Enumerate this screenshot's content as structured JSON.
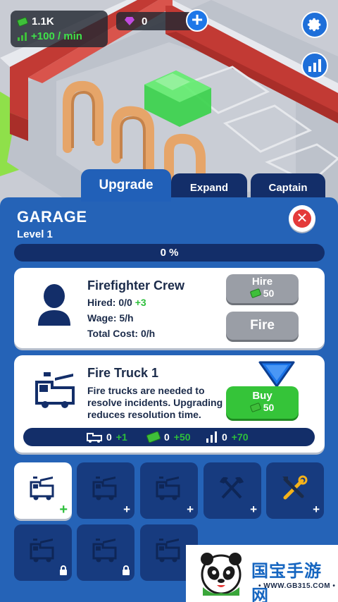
{
  "hud": {
    "money": "1.1K",
    "income_rate": "+100 / min",
    "gems": "0"
  },
  "tabs": [
    {
      "label": "Upgrade",
      "active": true
    },
    {
      "label": "Expand",
      "active": false
    },
    {
      "label": "Captain",
      "active": false
    }
  ],
  "panel": {
    "title": "GARAGE",
    "level": "Level 1",
    "progress_text": "0 %",
    "progress_fraction": 0
  },
  "crew_card": {
    "title": "Firefighter Crew",
    "hired_label": "Hired: 0/0",
    "hired_bonus": "+3",
    "wage": "Wage: 5/h",
    "total_cost": "Total Cost: 0/h",
    "hire_button": "Hire",
    "hire_price": "50",
    "fire_button": "Fire"
  },
  "truck_card": {
    "title": "Fire Truck 1",
    "description_lines": [
      "Fire trucks are needed to",
      "resolve incidents. Upgrading",
      "reduces resolution time."
    ],
    "buy_button": "Buy",
    "buy_price": "50",
    "stats": [
      {
        "icon": "fire-truck-icon",
        "value": "0",
        "bonus": "+1"
      },
      {
        "icon": "cash-icon",
        "value": "0",
        "bonus": "+50"
      },
      {
        "icon": "speed-icon",
        "value": "0",
        "bonus": "+70"
      }
    ]
  },
  "slots": [
    {
      "icon": "fire-truck-icon",
      "badge": "+",
      "selected": true
    },
    {
      "icon": "fire-truck-icon",
      "badge": "+",
      "selected": false
    },
    {
      "icon": "fire-truck-icon",
      "badge": "+",
      "selected": false
    },
    {
      "icon": "axes-icon",
      "badge": "+",
      "selected": false
    },
    {
      "icon": "tools-icon",
      "badge": "+",
      "selected": false
    },
    {
      "icon": "fire-truck-icon",
      "badge": "lock",
      "selected": false
    },
    {
      "icon": "fire-truck-icon",
      "badge": "lock",
      "selected": false
    },
    {
      "icon": "fire-truck-icon",
      "badge": "lock",
      "selected": false
    }
  ],
  "watermark": {
    "brand": "国宝手游网",
    "url": "• WWW.GB315.COM •"
  },
  "colors": {
    "panel_blue": "#2563b7",
    "dark_navy": "#132e69",
    "accent_green": "#35c439",
    "close_red": "#e43a3a",
    "brick_red": "#c23a34"
  }
}
